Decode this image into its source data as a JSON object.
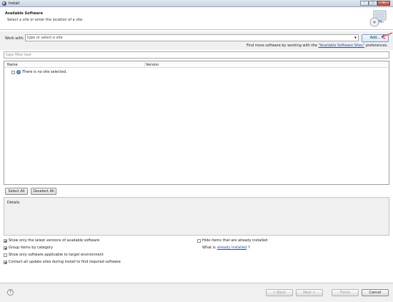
{
  "window": {
    "title": "Install"
  },
  "banner": {
    "heading": "Available Software",
    "description": "Select a site or enter the location of a site."
  },
  "work_with": {
    "label": "Work with:",
    "value": "type or select a site",
    "add_button": "Add...",
    "find_more_prefix": "Find more software by working with the ",
    "find_more_link": "\"Available Software Sites\"",
    "find_more_suffix": " preferences."
  },
  "filter": {
    "placeholder": "type filter text"
  },
  "tree": {
    "columns": [
      "Name",
      "Version"
    ],
    "message": "There is no site selected."
  },
  "selection_buttons": {
    "select_all": "Select All",
    "deselect_all": "Deselect All"
  },
  "details": {
    "label": "Details"
  },
  "options": {
    "latest_versions": {
      "label": "Show only the latest versions of available software",
      "checked": true
    },
    "group_by_category": {
      "label": "Group items by category",
      "checked": true
    },
    "applicable_only": {
      "label": "Show only software applicable to target environment",
      "checked": false
    },
    "contact_update_sites": {
      "label": "Contact all update sites during install to find required software",
      "checked": true
    },
    "hide_installed": {
      "label": "Hide items that are already installed",
      "checked": false
    },
    "what_is_prefix": "What is ",
    "what_is_link": "already installed",
    "what_is_suffix": "?"
  },
  "footer": {
    "back": "< Back",
    "next": "Next >",
    "finish": "Finish",
    "cancel": "Cancel"
  },
  "icons": {
    "help": "help-icon",
    "info": "info-icon",
    "banner": "install-wizard-icon"
  },
  "colors": {
    "link": "#1f4fb5",
    "add_button_border": "#6f9ed1",
    "arrow_annotation": "#d62b2b"
  }
}
